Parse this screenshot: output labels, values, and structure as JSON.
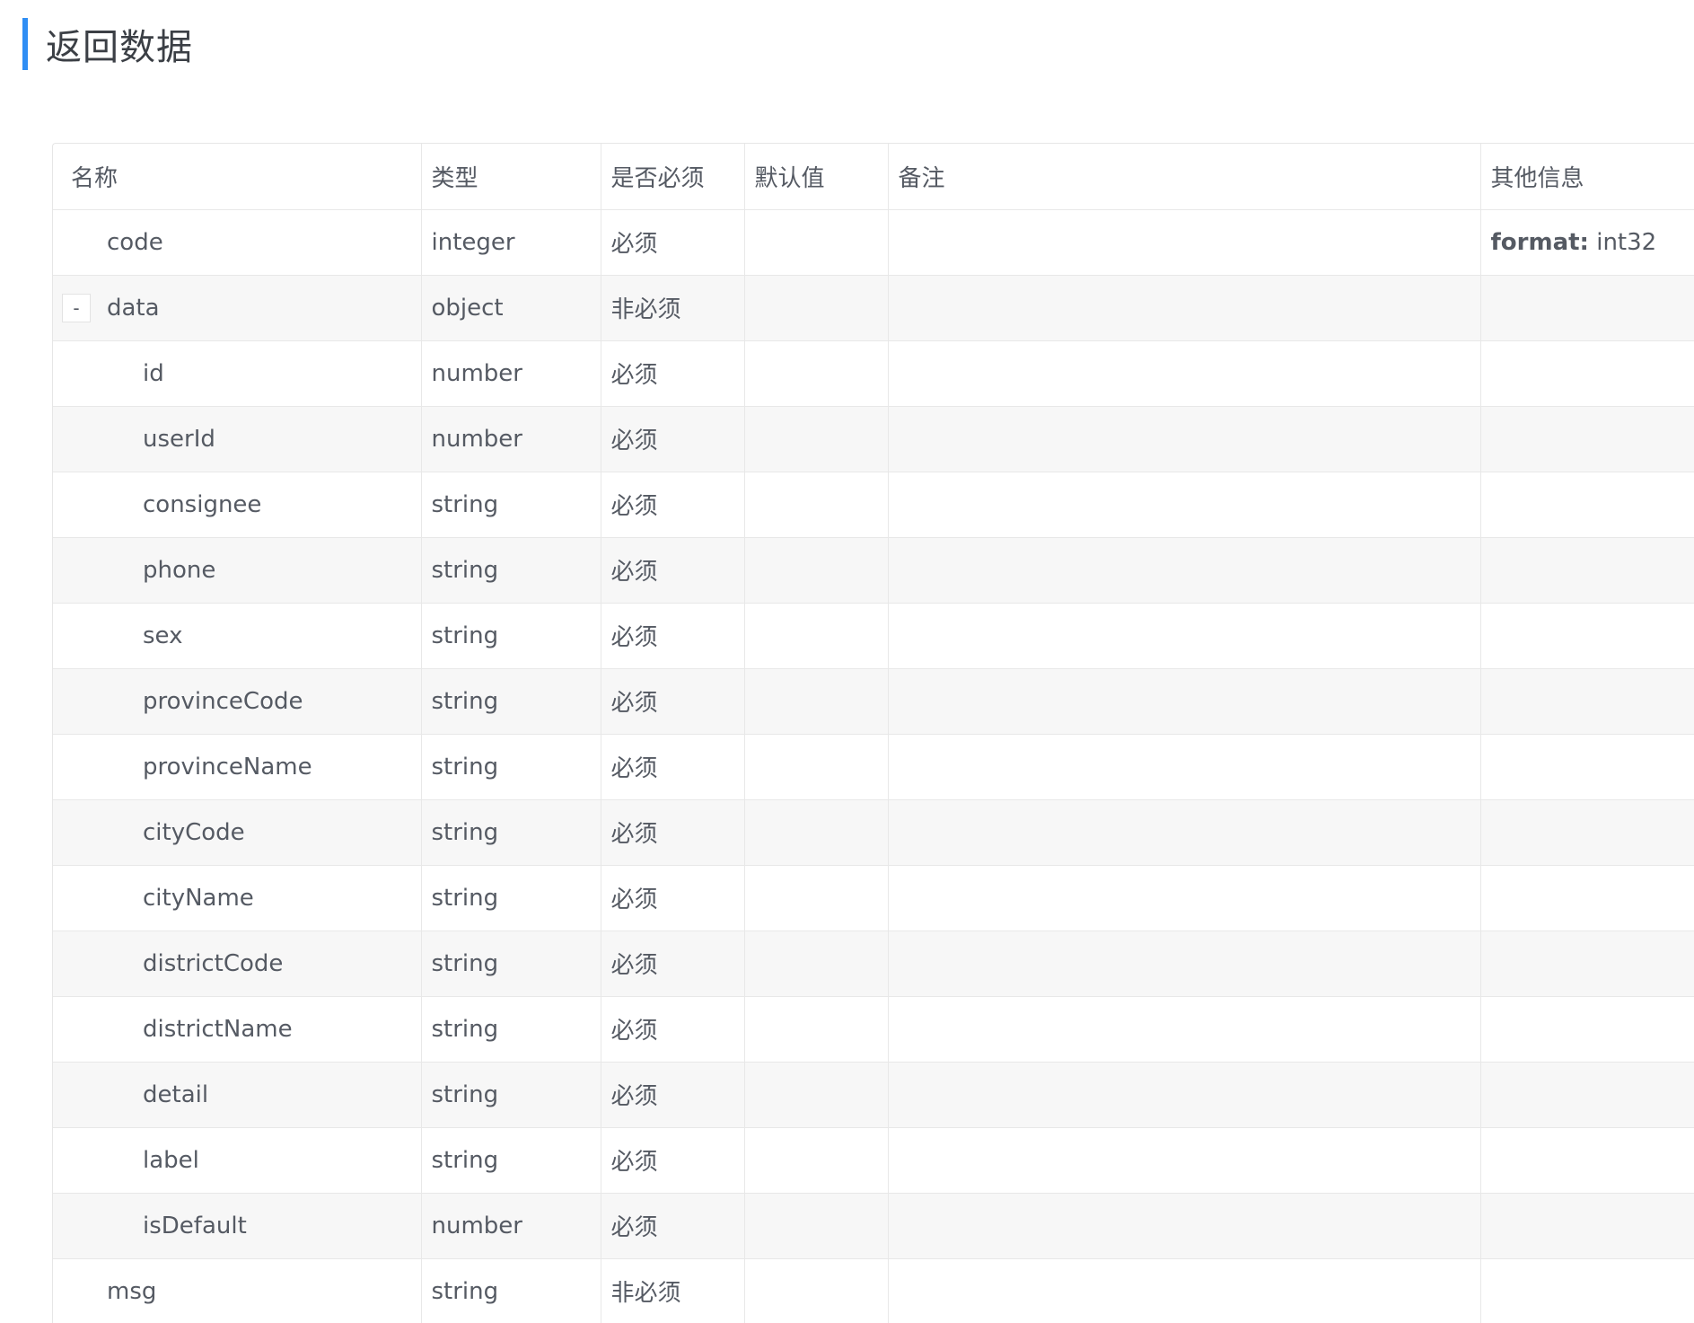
{
  "section": {
    "title": "返回数据"
  },
  "table": {
    "headers": {
      "name": "名称",
      "type": "类型",
      "required": "是否必须",
      "default": "默认值",
      "note": "备注",
      "other": "其他信息"
    },
    "rows": [
      {
        "name": "code",
        "type": "integer",
        "required": "必须",
        "default": "",
        "note": "",
        "other_key": "format:",
        "other_value": " int32",
        "level": 0
      },
      {
        "name": "data",
        "type": "object",
        "required": "非必须",
        "default": "",
        "note": "",
        "other_key": "",
        "other_value": "",
        "level": 0,
        "toggle": "-"
      },
      {
        "name": "id",
        "type": "number",
        "required": "必须",
        "default": "",
        "note": "",
        "other_key": "",
        "other_value": "",
        "level": 1
      },
      {
        "name": "userId",
        "type": "number",
        "required": "必须",
        "default": "",
        "note": "",
        "other_key": "",
        "other_value": "",
        "level": 1
      },
      {
        "name": "consignee",
        "type": "string",
        "required": "必须",
        "default": "",
        "note": "",
        "other_key": "",
        "other_value": "",
        "level": 1
      },
      {
        "name": "phone",
        "type": "string",
        "required": "必须",
        "default": "",
        "note": "",
        "other_key": "",
        "other_value": "",
        "level": 1
      },
      {
        "name": "sex",
        "type": "string",
        "required": "必须",
        "default": "",
        "note": "",
        "other_key": "",
        "other_value": "",
        "level": 1
      },
      {
        "name": "provinceCode",
        "type": "string",
        "required": "必须",
        "default": "",
        "note": "",
        "other_key": "",
        "other_value": "",
        "level": 1
      },
      {
        "name": "provinceName",
        "type": "string",
        "required": "必须",
        "default": "",
        "note": "",
        "other_key": "",
        "other_value": "",
        "level": 1
      },
      {
        "name": "cityCode",
        "type": "string",
        "required": "必须",
        "default": "",
        "note": "",
        "other_key": "",
        "other_value": "",
        "level": 1
      },
      {
        "name": "cityName",
        "type": "string",
        "required": "必须",
        "default": "",
        "note": "",
        "other_key": "",
        "other_value": "",
        "level": 1
      },
      {
        "name": "districtCode",
        "type": "string",
        "required": "必须",
        "default": "",
        "note": "",
        "other_key": "",
        "other_value": "",
        "level": 1
      },
      {
        "name": "districtName",
        "type": "string",
        "required": "必须",
        "default": "",
        "note": "",
        "other_key": "",
        "other_value": "",
        "level": 1
      },
      {
        "name": "detail",
        "type": "string",
        "required": "必须",
        "default": "",
        "note": "",
        "other_key": "",
        "other_value": "",
        "level": 1
      },
      {
        "name": "label",
        "type": "string",
        "required": "必须",
        "default": "",
        "note": "",
        "other_key": "",
        "other_value": "",
        "level": 1
      },
      {
        "name": "isDefault",
        "type": "number",
        "required": "必须",
        "default": "",
        "note": "",
        "other_key": "",
        "other_value": "",
        "level": 1
      },
      {
        "name": "msg",
        "type": "string",
        "required": "非必须",
        "default": "",
        "note": "",
        "other_key": "",
        "other_value": "",
        "level": 0
      }
    ]
  }
}
